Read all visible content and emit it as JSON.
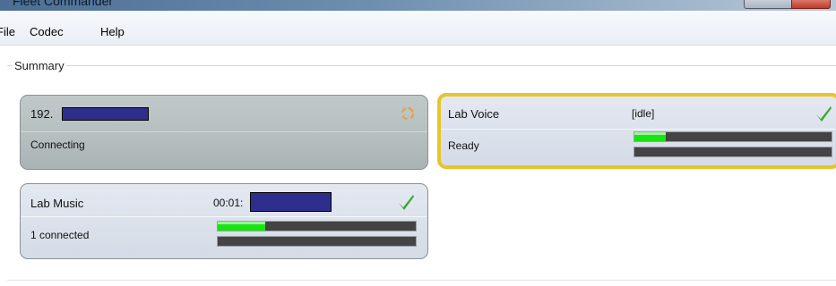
{
  "window": {
    "title": "Fleet Commander"
  },
  "menu": {
    "items": [
      "File",
      "Codec",
      "Help"
    ]
  },
  "summary": {
    "label": "Summary"
  },
  "codecs": {
    "connecting": {
      "name": "192.",
      "status": "Connecting",
      "icon": "busy-icon"
    },
    "lab_voice": {
      "name": "Lab Voice",
      "info": "[idle]",
      "status": "Ready",
      "icon": "check-icon",
      "meters": [
        0.16,
        0.0
      ]
    },
    "lab_music": {
      "name": "Lab Music",
      "info": "00:01:",
      "status": "1 connected",
      "icon": "check-icon",
      "meters": [
        0.24,
        0.0
      ]
    }
  },
  "colors": {
    "selected_border": "#e8c42b",
    "meter_fill": "#19e312",
    "meter_track": "#444444",
    "redaction": "#2e2f8c",
    "check": "#3aa832"
  }
}
